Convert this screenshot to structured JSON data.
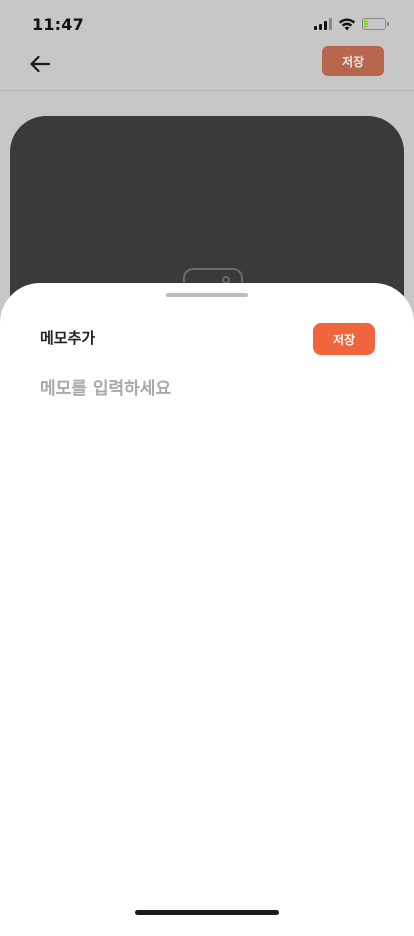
{
  "status_bar": {
    "time": "11:47",
    "battery_level": 0.2,
    "icons": [
      "cellular-signal-icon",
      "wifi-icon",
      "battery-icon"
    ]
  },
  "header": {
    "back_icon": "arrow-left-icon",
    "save_label": "저장"
  },
  "sheet": {
    "title": "메모추가",
    "save_label": "저장",
    "memo_value": "",
    "memo_placeholder": "메모를 입력하세요"
  },
  "colors": {
    "accent": "#f0643e",
    "accent_dimmed": "#b8674f",
    "card": "#3a3a3a",
    "overlay": "#c7c7c7"
  }
}
